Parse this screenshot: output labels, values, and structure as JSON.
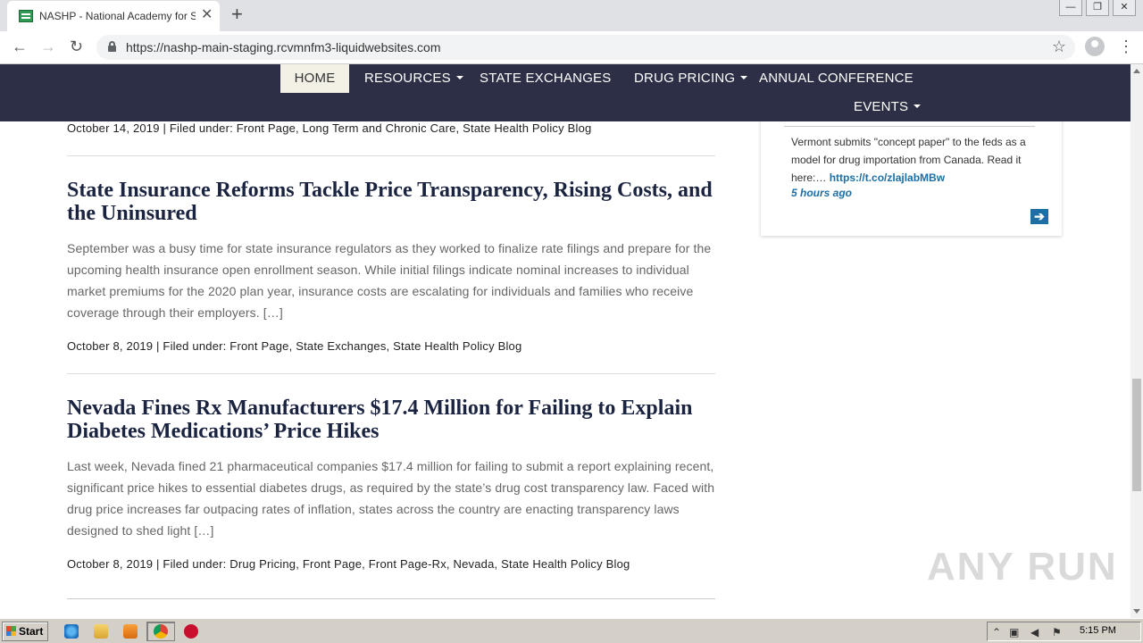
{
  "browser": {
    "tab_title": "NASHP - National Academy for State",
    "tab_close": "✕",
    "new_tab": "+",
    "url": "https://nashp-main-staging.rcvmnfm3-liquidwebsites.com",
    "back": "←",
    "forward": "→",
    "reload": "↻",
    "bookmark": "☆",
    "menu": "⋮",
    "window_buttons": [
      "—",
      "❐",
      "✕"
    ]
  },
  "sitenav": {
    "items": [
      {
        "label": "HOME",
        "dropdown": false
      },
      {
        "label": "RESOURCES",
        "dropdown": true
      },
      {
        "label": "STATE EXCHANGES",
        "dropdown": false
      },
      {
        "label": "DRUG PRICING",
        "dropdown": true
      },
      {
        "label": "ANNUAL CONFERENCE",
        "dropdown": false
      },
      {
        "label": "EVENTS",
        "dropdown": true
      }
    ]
  },
  "posts": [
    {
      "meta_prefix": "October 14, 2019 | Filed under: ",
      "categories": "Front Page, Long Term and Chronic Care, State Health Policy Blog"
    },
    {
      "title": "State Insurance Reforms Tackle Price Transparency, Rising Costs, and the Uninsured",
      "excerpt": "September was a busy time for state insurance regulators as they worked to finalize rate filings and prepare for the upcoming health insurance open enrollment season. While initial filings indicate nominal increases to individual market premiums for the 2020 plan year, insurance costs are escalating for individuals and families who receive coverage through their employers.   […]",
      "meta_prefix": "October 8, 2019 | Filed under: ",
      "categories": "Front Page, State Exchanges, State Health Policy Blog"
    },
    {
      "title": "Nevada Fines Rx Manufacturers $17.4 Million for Failing to Explain Diabetes Medications’ Price Hikes",
      "excerpt": "Last week, Nevada fined 21 pharmaceutical companies $17.4 million for failing to submit a report explaining recent, significant price hikes to essential diabetes drugs, as required by the state’s drug cost transparency law. Faced with drug price increases far outpacing rates of inflation, states across the country are enacting transparency laws designed to shed light […]",
      "meta_prefix": "October 8, 2019 | Filed under: ",
      "categories": "Drug Pricing, Front Page, Front Page-Rx, Nevada, State Health Policy Blog"
    }
  ],
  "tweet": {
    "text": "Vermont submits \"concept paper\" to the feds as a model for drug importation from Canada. Read it here:…",
    "link": "https://t.co/zlajlabMBw",
    "time": "5 hours ago",
    "arrow": "➔"
  },
  "watermark": "ANY RUN",
  "taskbar": {
    "start_label": "Start",
    "clock": "5:15 PM",
    "apps": [
      "internet-explorer",
      "file-explorer",
      "media-player",
      "chrome",
      "antivirus"
    ]
  },
  "colors": {
    "nav_bg": "#2c2f45",
    "home_bg": "#f3f0e6",
    "title_color": "#1a2340",
    "link_color": "#1c6fa5"
  }
}
